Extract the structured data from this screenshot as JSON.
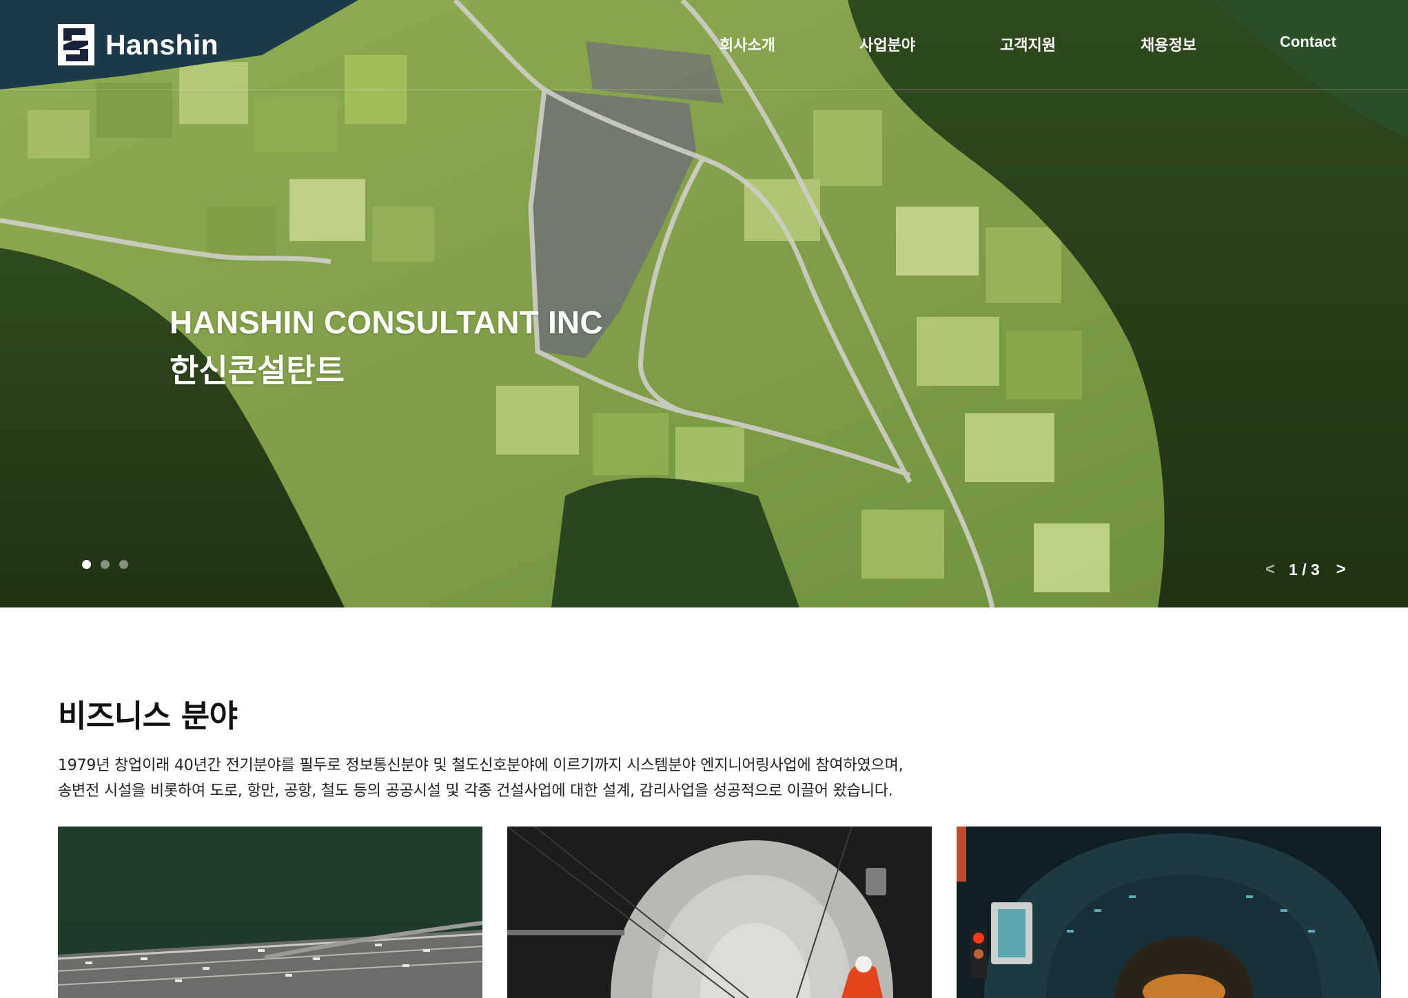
{
  "header": {
    "logo_text": "Hanshin",
    "nav": [
      "회사소개",
      "사업분야",
      "고객지원",
      "채용정보",
      "Contact"
    ]
  },
  "hero": {
    "title_en": "HANSHIN CONSULTANT INC",
    "title_ko": "한신콘설탄트",
    "slides_total": 3,
    "slide_current": 1,
    "pager_text": "1 / 3",
    "prev_symbol": "<",
    "next_symbol": ">"
  },
  "business": {
    "title": "비즈니스 분야",
    "desc_line1": "1979년 창업이래 40년간 전기분야를 필두로 정보통신분야 및 철도신호분야에 이르기까지 시스템분야 엔지니어링사업에 참여하였으며,",
    "desc_line2": "송변전 시설을 비롯하여 도로, 항만, 공항, 철도 등의 공공시설 및 각종 건설사업에 대한 설계, 감리사업을 성공적으로 이끌어 왔습니다."
  }
}
